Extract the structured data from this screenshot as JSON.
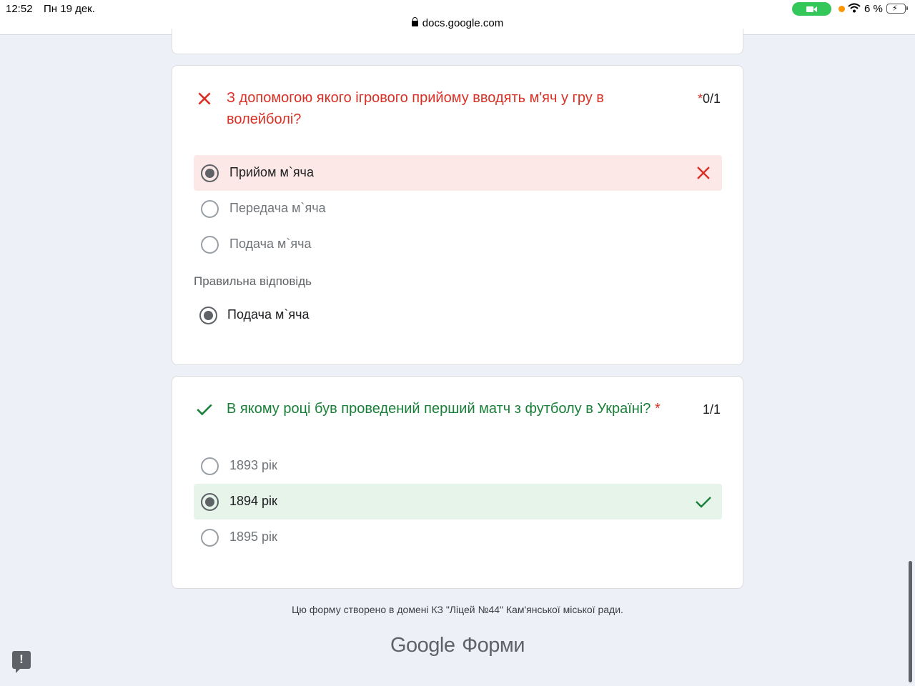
{
  "status_bar": {
    "time": "12:52",
    "date": "Пн 19 дек.",
    "url": "docs.google.com",
    "battery": "6 %"
  },
  "questions": [
    {
      "title": "З допомогою якого ігрового прийому вводять м'яч у гру в волейболі?",
      "required_mark": "*",
      "score": "0/1",
      "options": [
        "Прийом м`яча",
        "Передача м`яча",
        "Подача м`яча"
      ],
      "correct_heading": "Правильна відповідь",
      "correct_answer": "Подача м`яча"
    },
    {
      "title": "В якому році був проведений перший матч з футболу в Україні?",
      "required_mark": "*",
      "score": "1/1",
      "options": [
        "1893 рік",
        "1894 рік",
        "1895 рік"
      ]
    }
  ],
  "footer": {
    "domain_text": "Цю форму створено в домені КЗ \"Ліцей №44\" Кам'янської міської ради.",
    "logo_google": "Google",
    "logo_forms": "Форми"
  },
  "colors": {
    "wrong": "#d93025",
    "right": "#188038",
    "wrong_bg": "#fce8e6",
    "right_bg": "#e6f4ea",
    "page_bg": "#edf0f7"
  }
}
